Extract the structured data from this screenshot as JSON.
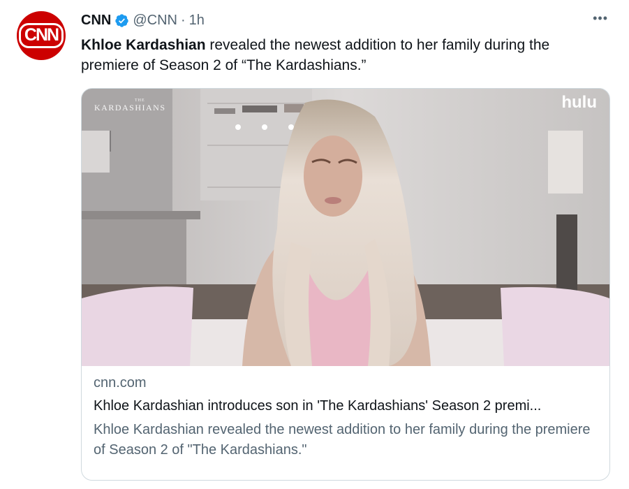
{
  "tweet": {
    "avatar_text": "CNN",
    "author_name": "CNN",
    "handle": "@CNN",
    "separator": "·",
    "time": "1h",
    "more": "•••",
    "text_bold": "Khloe Kardashian",
    "text_rest": " revealed the newest addition to her family during the premiere of Season 2 of “The Kardashians.”"
  },
  "card": {
    "show_watermark_top": "THE",
    "show_watermark": "KARDASHIANS",
    "network_watermark": "hulu",
    "domain": "cnn.com",
    "title": "Khloe Kardashian introduces son in 'The Kardashians' Season 2 premi...",
    "description": "Khloe Kardashian revealed the newest addition to her family during the premiere of Season 2 of \"The Kardashians.\""
  },
  "colors": {
    "brand_red": "#cc0000",
    "verified_blue": "#1d9bf0",
    "secondary_text": "#536471",
    "primary_text": "#0f1419"
  }
}
